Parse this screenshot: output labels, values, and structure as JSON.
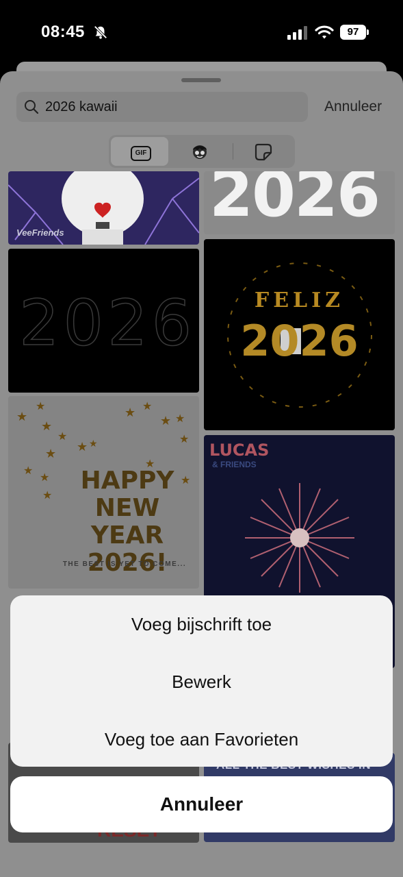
{
  "status_bar": {
    "time": "08:45",
    "battery_level": "97",
    "icons": [
      "bell-slash-icon",
      "cellular-signal-icon",
      "wifi-icon",
      "battery-icon"
    ]
  },
  "search": {
    "query": "2026 kawaii",
    "cancel_label": "Annuleer"
  },
  "segments": {
    "gif_label": "GIF",
    "items": [
      "gif-tab-icon",
      "avatar-face-icon",
      "sticker-icon"
    ],
    "selected": "gif"
  },
  "gifs": {
    "tile1_caption": "VeeFriends",
    "tile2_text": "2026",
    "tile3_text": "2026",
    "tile4_line1": "FELIZ",
    "tile4_line2": "2026",
    "tile5_line1": "HAPPY",
    "tile5_line2": "NEW YEAR",
    "tile5_line3": "2026!",
    "tile5_tagline": "THE BEST IS YET TO COME...",
    "tile6_logo": "LUCAS",
    "tile6_logo_sub": "& FRIENDS",
    "tile7_text": "RESET",
    "tile8_text": "ALL THE BEST WISHES IN"
  },
  "action_sheet": {
    "add_caption": "Voeg bijschrift toe",
    "edit": "Bewerk",
    "add_favorites": "Voeg toe aan Favorieten",
    "cancel": "Annuleer"
  },
  "colors": {
    "sheet_dim": "#8f8f8f",
    "action_bg": "#f2f2f2",
    "cancel_bg": "#ffffff"
  }
}
